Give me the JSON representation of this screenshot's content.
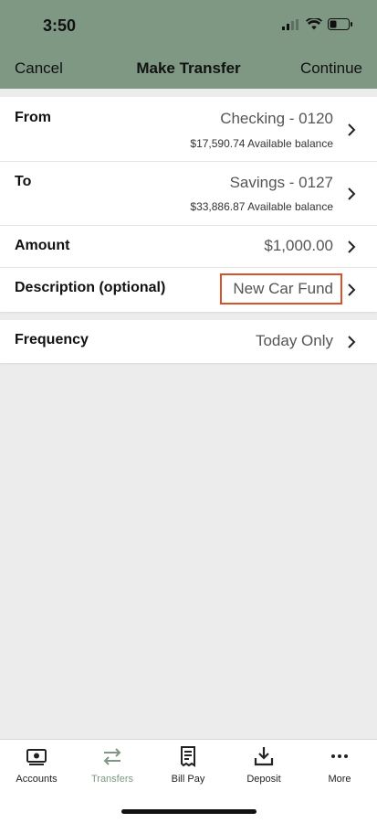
{
  "status": {
    "time": "3:50"
  },
  "nav": {
    "cancel": "Cancel",
    "title": "Make Transfer",
    "continue": "Continue"
  },
  "form": {
    "from": {
      "label": "From",
      "value": "Checking - 0120",
      "balance": "$17,590.74 Available balance"
    },
    "to": {
      "label": "To",
      "value": "Savings - 0127",
      "balance": "$33,886.87 Available balance"
    },
    "amount": {
      "label": "Amount",
      "value": "$1,000.00"
    },
    "description": {
      "label": "Description (optional)",
      "value": "New Car Fund"
    },
    "frequency": {
      "label": "Frequency",
      "value": "Today Only"
    }
  },
  "tabs": [
    {
      "label": "Accounts",
      "icon": "accounts-icon"
    },
    {
      "label": "Transfers",
      "icon": "transfers-icon",
      "active": true
    },
    {
      "label": "Bill Pay",
      "icon": "bill-pay-icon"
    },
    {
      "label": "Deposit",
      "icon": "deposit-icon"
    },
    {
      "label": "More",
      "icon": "more-icon"
    }
  ],
  "colors": {
    "header": "#7e9884",
    "highlight": "#d5542d",
    "active_tab": "#7e9884"
  }
}
